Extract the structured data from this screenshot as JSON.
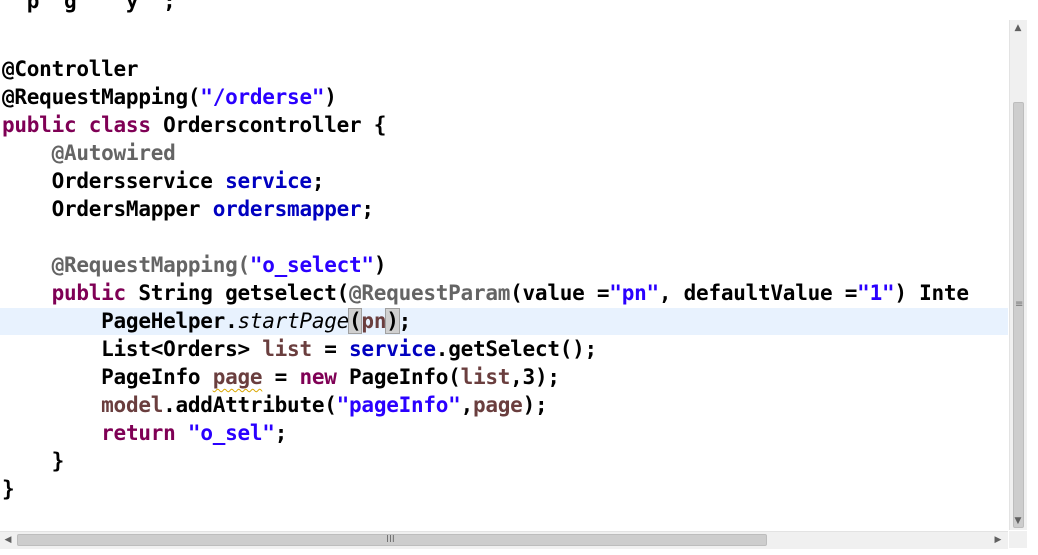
{
  "editor": {
    "lines": [
      {
        "segments": [
          {
            "cls": "",
            "text": "@Controller"
          }
        ]
      },
      {
        "segments": [
          {
            "cls": "",
            "text": "@RequestMapping("
          },
          {
            "cls": "str",
            "text": "\"/orderse\""
          },
          {
            "cls": "",
            "text": ")"
          }
        ]
      },
      {
        "segments": [
          {
            "cls": "kw",
            "text": "public class "
          },
          {
            "cls": "",
            "text": "Orderscontroller {"
          }
        ]
      },
      {
        "segments": [
          {
            "cls": "",
            "text": "    "
          },
          {
            "cls": "ann",
            "text": "@Autowired"
          }
        ]
      },
      {
        "segments": [
          {
            "cls": "",
            "text": "    Ordersservice "
          },
          {
            "cls": "fld",
            "text": "service"
          },
          {
            "cls": "",
            "text": ";"
          }
        ]
      },
      {
        "segments": [
          {
            "cls": "",
            "text": "    OrdersMapper "
          },
          {
            "cls": "fld",
            "text": "ordersmapper"
          },
          {
            "cls": "",
            "text": ";"
          }
        ]
      },
      {
        "segments": []
      },
      {
        "segments": [
          {
            "cls": "",
            "text": "    "
          },
          {
            "cls": "ann",
            "text": "@RequestMapping("
          },
          {
            "cls": "str",
            "text": "\"o_select\""
          },
          {
            "cls": "",
            "text": ")"
          }
        ]
      },
      {
        "segments": [
          {
            "cls": "",
            "text": "    "
          },
          {
            "cls": "kw",
            "text": "public"
          },
          {
            "cls": "",
            "text": " String getselect("
          },
          {
            "cls": "ann",
            "text": "@RequestParam"
          },
          {
            "cls": "",
            "text": "(value ="
          },
          {
            "cls": "str",
            "text": "\"pn\""
          },
          {
            "cls": "",
            "text": ", defaultValue ="
          },
          {
            "cls": "str",
            "text": "\"1\""
          },
          {
            "cls": "",
            "text": ") Inte"
          }
        ]
      },
      {
        "segments": [
          {
            "cls": "",
            "text": "        PageHelper."
          },
          {
            "cls": "ital",
            "text": "startPage"
          },
          {
            "cls": "brk",
            "text": "("
          },
          {
            "cls": "loc",
            "text": "pn"
          },
          {
            "cls": "caret",
            "text": ""
          },
          {
            "cls": "brk",
            "text": ")"
          },
          {
            "cls": "",
            "text": ";"
          }
        ]
      },
      {
        "segments": [
          {
            "cls": "",
            "text": "        List<Orders> "
          },
          {
            "cls": "loc",
            "text": "list"
          },
          {
            "cls": "",
            "text": " = "
          },
          {
            "cls": "fld",
            "text": "service"
          },
          {
            "cls": "",
            "text": ".getSelect();"
          }
        ]
      },
      {
        "segments": [
          {
            "cls": "",
            "text": "        PageInfo "
          },
          {
            "cls": "loc wavy",
            "text": "page"
          },
          {
            "cls": "",
            "text": " = "
          },
          {
            "cls": "kw",
            "text": "new"
          },
          {
            "cls": "",
            "text": " PageInfo("
          },
          {
            "cls": "loc",
            "text": "list"
          },
          {
            "cls": "",
            "text": ",3);"
          }
        ]
      },
      {
        "segments": [
          {
            "cls": "",
            "text": "        "
          },
          {
            "cls": "loc",
            "text": "model"
          },
          {
            "cls": "",
            "text": ".addAttribute("
          },
          {
            "cls": "str",
            "text": "\"pageInfo\""
          },
          {
            "cls": "",
            "text": ","
          },
          {
            "cls": "loc",
            "text": "page"
          },
          {
            "cls": "",
            "text": ");"
          }
        ]
      },
      {
        "segments": [
          {
            "cls": "",
            "text": "        "
          },
          {
            "cls": "kw",
            "text": "return"
          },
          {
            "cls": "",
            "text": " "
          },
          {
            "cls": "str",
            "text": "\"o_sel\""
          },
          {
            "cls": "",
            "text": ";"
          }
        ]
      },
      {
        "segments": [
          {
            "cls": "",
            "text": "    }"
          }
        ]
      },
      {
        "segments": [
          {
            "cls": "",
            "text": "}"
          }
        ]
      }
    ],
    "current_line": 9
  },
  "scrollbars": {
    "up_arrow": "▲",
    "down_arrow": "▼",
    "left_arrow": "◀",
    "right_arrow": "▶",
    "h_grip": "III",
    "v_grip": "≡"
  }
}
